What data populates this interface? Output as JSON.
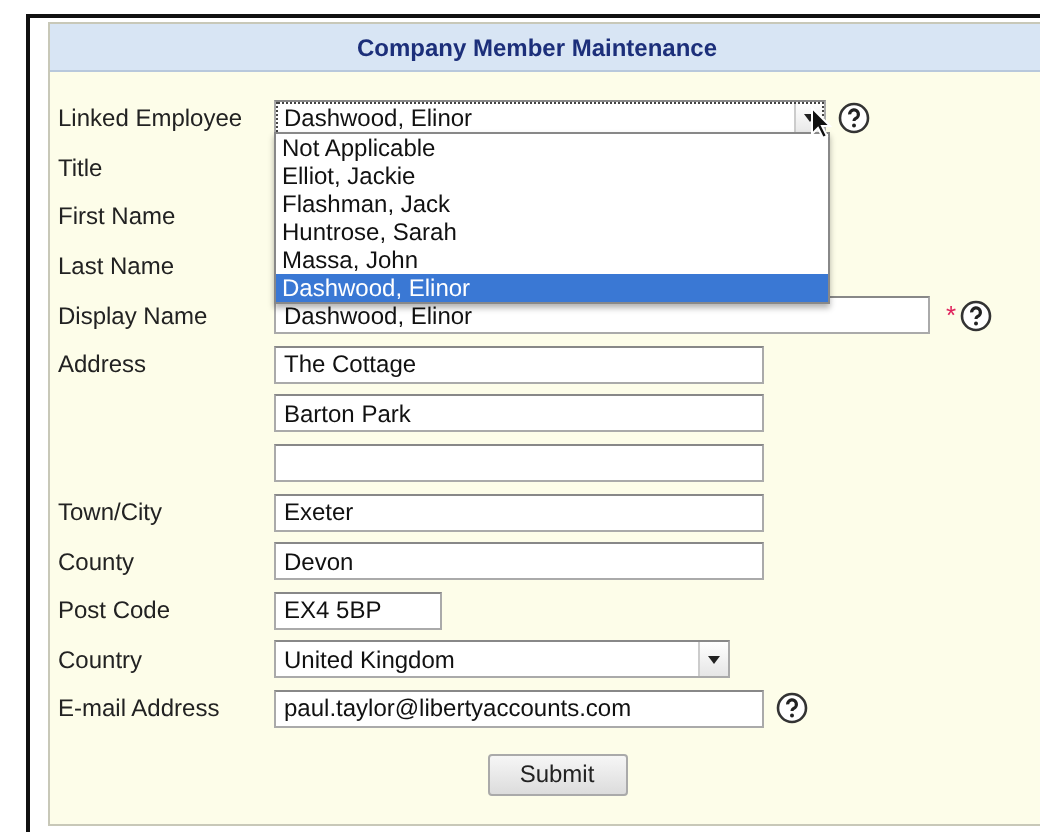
{
  "form": {
    "title": "Company Member Maintenance",
    "rows": [
      {
        "label": "Linked Employee",
        "kind": "select",
        "value": "Dashwood, Elinor",
        "required": false,
        "help": true,
        "focused": true,
        "dropdown": {
          "expanded": true,
          "options": [
            {
              "label": "Not Applicable",
              "selected": false
            },
            {
              "label": "Elliot, Jackie",
              "selected": false
            },
            {
              "label": "Flashman, Jack",
              "selected": false
            },
            {
              "label": "Huntrose, Sarah",
              "selected": false
            },
            {
              "label": "Massa, John",
              "selected": false
            },
            {
              "label": "Dashwood, Elinor",
              "selected": true
            }
          ]
        }
      },
      {
        "label": "Title",
        "kind": "covered",
        "required": false,
        "help": false
      },
      {
        "label": "First Name",
        "kind": "covered",
        "required": false,
        "help": false
      },
      {
        "label": "Last Name",
        "kind": "covered",
        "required": false,
        "help": false
      },
      {
        "label": "Display Name",
        "kind": "text",
        "value": "Dashwood, Elinor",
        "required": true,
        "help": true
      },
      {
        "label": "Address",
        "kind": "text",
        "value": "The Cottage",
        "required": false,
        "help": false
      },
      {
        "kind": "text",
        "value": "Barton Park",
        "required": false,
        "help": false
      },
      {
        "kind": "text",
        "required": false,
        "help": false
      },
      {
        "label": "Town/City",
        "kind": "text",
        "value": "Exeter",
        "required": false,
        "help": false
      },
      {
        "label": "County",
        "kind": "text",
        "value": "Devon",
        "required": false,
        "help": false
      },
      {
        "label": "Post Code",
        "kind": "text",
        "value": "EX4 5BP",
        "required": false,
        "help": false
      },
      {
        "label": "Country",
        "kind": "select",
        "value": "United Kingdom",
        "required": false,
        "help": false,
        "focused": false
      },
      {
        "label": "E-mail Address",
        "kind": "text",
        "value": "paul.taylor@libertyaccounts.com",
        "required": false,
        "help": true
      }
    ],
    "required_mark": "*",
    "submit": "Submit"
  }
}
